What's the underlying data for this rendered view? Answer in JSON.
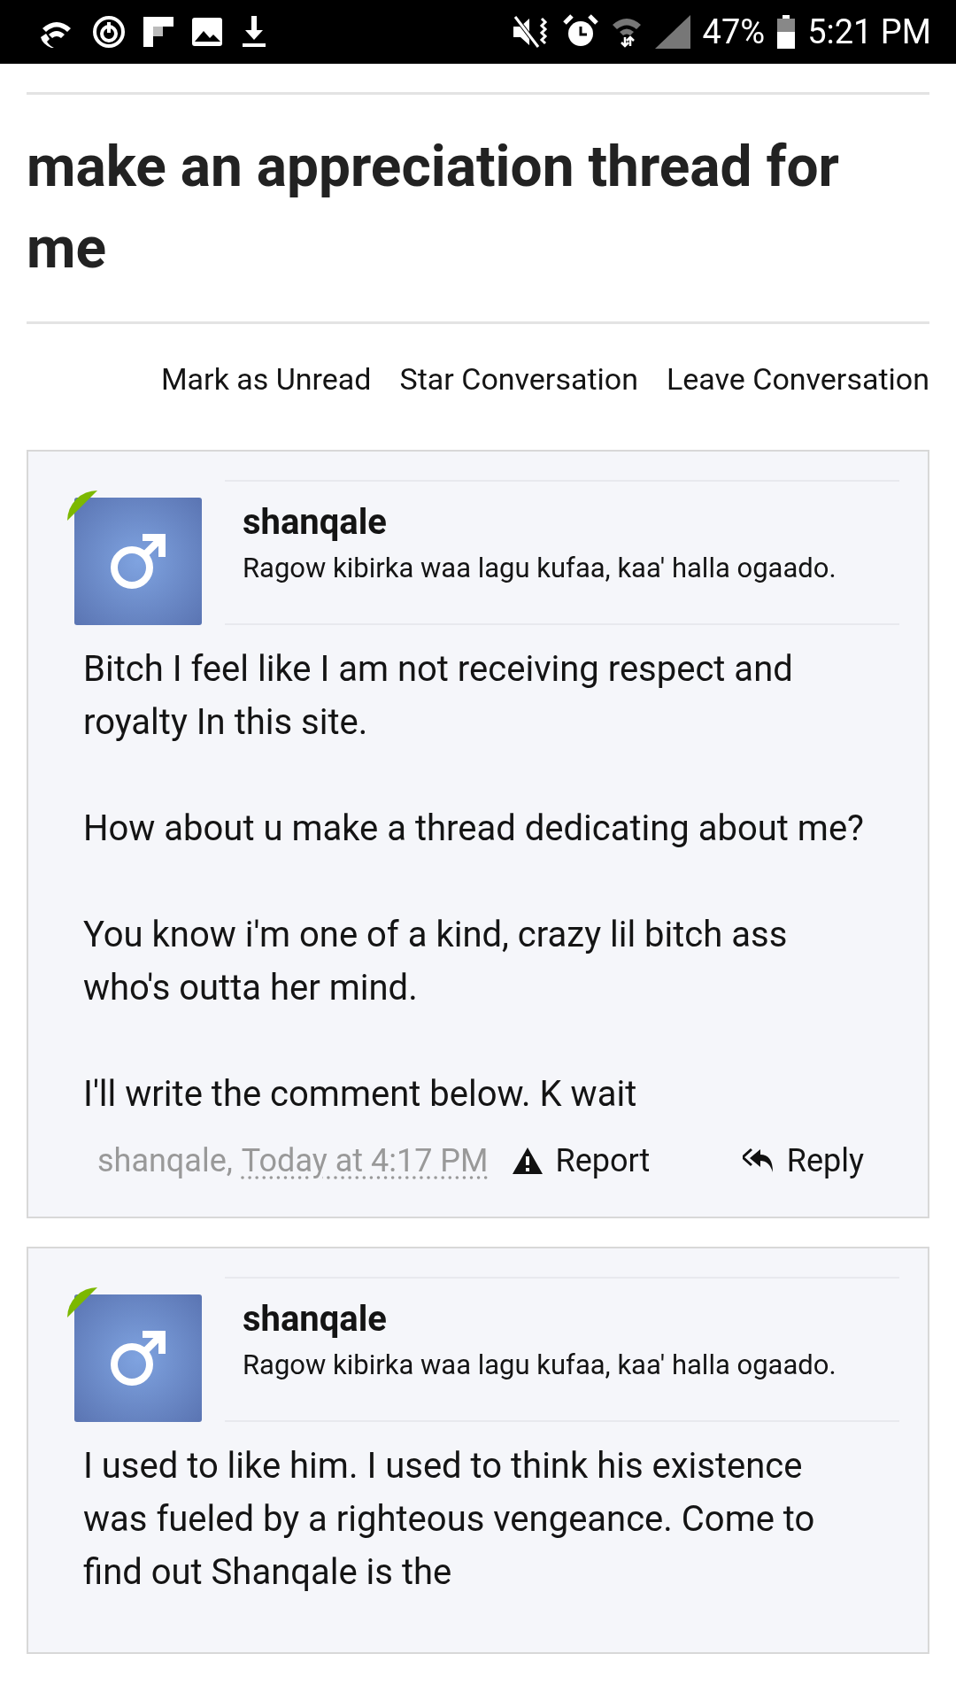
{
  "status_bar": {
    "battery": "47%",
    "time": "5:21 PM"
  },
  "thread_title": "make an appreciation thread for me",
  "actions": [
    "Mark as Unread",
    "Star Conversation",
    "Leave Conversation"
  ],
  "messages": [
    {
      "author": "shanqale",
      "online": true,
      "user_title": "Ragow kibirka waa lagu kufaa, kaa' halla ogaado.",
      "paragraphs": [
        "Bitch I feel like I am not receiving respect and royalty In this site.",
        "How about u make a thread dedicating about me?",
        "You know i'm one of a kind, crazy lil bitch ass who's outta her mind.",
        "I'll write the comment below. K wait"
      ],
      "footer": {
        "author": "shanqale,",
        "date": "Today at 4:17 PM",
        "report": "Report",
        "reply": "Reply"
      }
    },
    {
      "author": "shanqale",
      "online": true,
      "user_title": "Ragow kibirka waa lagu kufaa, kaa' halla ogaado.",
      "paragraphs": [
        "I used to like him. I used to think his existence was fueled by a righteous vengeance. Come to find out Shanqale is the"
      ]
    }
  ]
}
